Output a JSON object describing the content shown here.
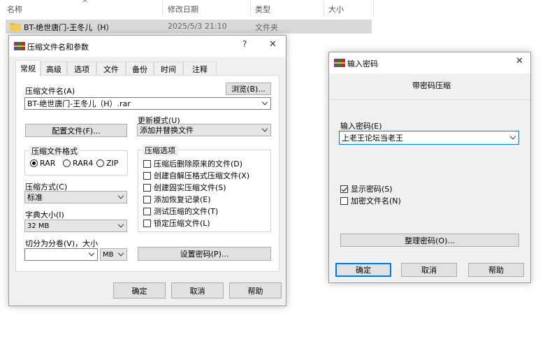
{
  "explorer": {
    "columns": [
      "名称",
      "修改日期",
      "类型",
      "大小"
    ],
    "row": {
      "name": "BT-绝世唐门-王冬儿（H）",
      "date": "2025/5/3 21:10",
      "type": "文件夹"
    },
    "collapse_arrow": "^"
  },
  "archive_dialog": {
    "title": "压缩文件名和参数",
    "help_glyph": "?",
    "close_glyph": "✕",
    "tabs": [
      "常规",
      "高级",
      "选项",
      "文件",
      "备份",
      "时间",
      "注释"
    ],
    "archive_name_label": "压缩文件名(A)",
    "browse_label": "浏览(B)...",
    "archive_name_value": "BT-绝世唐门-王冬儿（H）.rar",
    "profiles_label": "配置文件(F)...",
    "update_mode_label": "更新模式(U)",
    "update_mode_value": "添加并替换文件",
    "format_group_title": "压缩文件格式",
    "formats": [
      "RAR",
      "RAR4",
      "ZIP"
    ],
    "selected_format": "RAR",
    "method_label": "压缩方式(C)",
    "method_value": "标准",
    "dict_label": "字典大小(I)",
    "dict_value": "32 MB",
    "split_label": "切分为分卷(V)，大小",
    "split_value": "",
    "split_unit": "MB",
    "options_group_title": "压缩选项",
    "options": [
      {
        "label": "压缩后删除原来的文件(D)",
        "checked": false
      },
      {
        "label": "创建自解压格式压缩文件(X)",
        "checked": false
      },
      {
        "label": "创建固实压缩文件(S)",
        "checked": false
      },
      {
        "label": "添加恢复记录(E)",
        "checked": false
      },
      {
        "label": "测试压缩的文件(T)",
        "checked": false
      },
      {
        "label": "锁定压缩文件(L)",
        "checked": false
      }
    ],
    "set_password_label": "设置密码(P)...",
    "ok_label": "确定",
    "cancel_label": "取消",
    "help_label": "帮助"
  },
  "password_dialog": {
    "title": "输入密码",
    "close_glyph": "✕",
    "header": "带密码压缩",
    "enter_password_label": "输入密码(E)",
    "password_value": "上老王论坛当老王",
    "show_password_label": "显示密码(S)",
    "show_password_checked": true,
    "encrypt_names_label": "加密文件名(N)",
    "encrypt_names_checked": false,
    "organize_label": "整理密码(O)...",
    "ok_label": "确定",
    "cancel_label": "取消",
    "help_label": "帮助"
  }
}
